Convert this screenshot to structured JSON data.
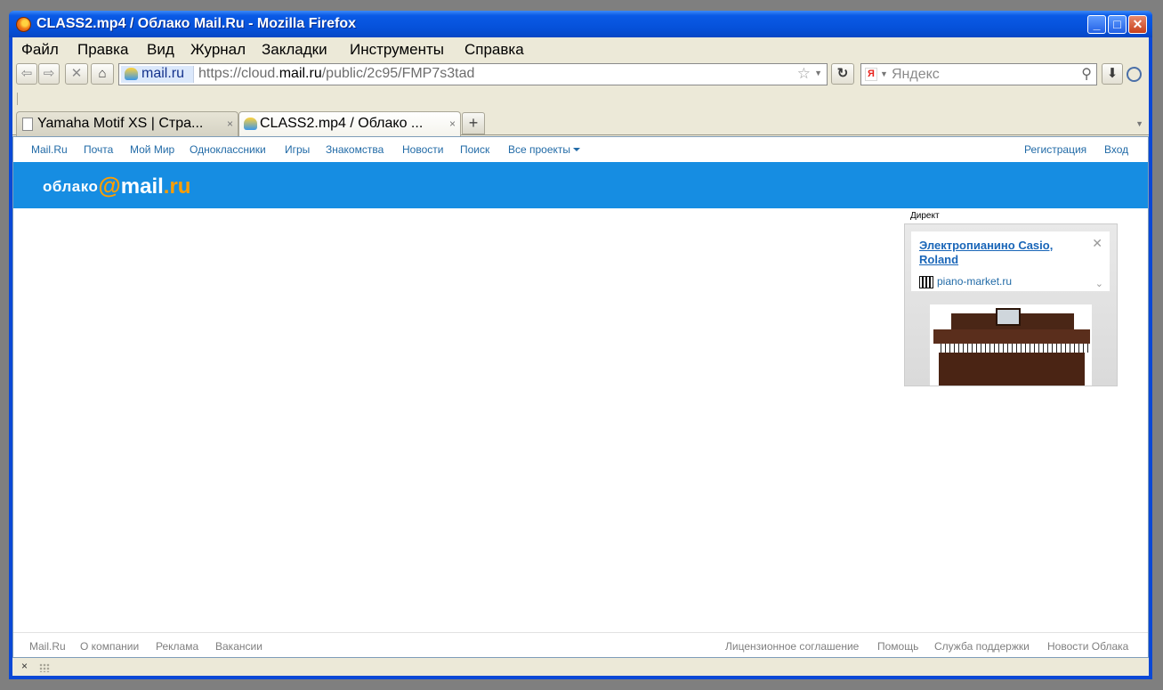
{
  "window": {
    "title": "CLASS2.mp4 / Облако Mail.Ru - Mozilla Firefox",
    "controls": {
      "minimize": "_",
      "maximize": "□",
      "close": "✕"
    }
  },
  "menubar": {
    "items": [
      {
        "label": "Файл"
      },
      {
        "label": "Правка"
      },
      {
        "label": "Вид"
      },
      {
        "label": "Журнал"
      },
      {
        "label": "Закладки"
      },
      {
        "label": "Инструменты"
      },
      {
        "label": "Справка"
      }
    ]
  },
  "navbar": {
    "back": "⇦",
    "forward": "⇨",
    "stop": "✕",
    "home": "⌂",
    "site_identity": "mail.ru",
    "url_prefix": "https://cloud.",
    "url_host": "mail.ru",
    "url_path": "/public/2c95/FMP7s3tad",
    "star": "☆",
    "url_dropdown": "▼",
    "reload": "↻",
    "search_engine_glyph": "Я",
    "search_dropdown": "▼",
    "search_placeholder": "Яндекс",
    "search_glyph": "⚲",
    "download": "⬇"
  },
  "tabs": [
    {
      "label": "Yamaha Motif XS | Стра...",
      "close": "×",
      "active": false
    },
    {
      "label": "CLASS2.mp4 / Облако ...",
      "close": "×",
      "active": true
    }
  ],
  "new_tab": "+",
  "tab_list": "▼",
  "portal_bar": {
    "left": [
      {
        "label": "Mail.Ru"
      },
      {
        "label": "Почта"
      },
      {
        "label": "Мой Мир"
      },
      {
        "label": "Одноклассники"
      },
      {
        "label": "Игры"
      },
      {
        "label": "Знакомства"
      },
      {
        "label": "Новости"
      },
      {
        "label": "Поиск"
      },
      {
        "label": "Все проекты"
      }
    ],
    "right": [
      {
        "label": "Регистрация"
      },
      {
        "label": "Вход"
      }
    ]
  },
  "logo": {
    "word": "облако",
    "at": "@",
    "mail": "mail",
    "ru": ".ru"
  },
  "ad": {
    "label": "Директ",
    "title": "Электропианино Casio, Roland",
    "domain": "piano-market.ru",
    "close": "✕",
    "expand": "⌄"
  },
  "footer": {
    "left": [
      {
        "label": "Mail.Ru"
      },
      {
        "label": "О компании"
      },
      {
        "label": "Реклама"
      },
      {
        "label": "Вакансии"
      }
    ],
    "right": [
      {
        "label": "Лицензионное соглашение"
      },
      {
        "label": "Помощь"
      },
      {
        "label": "Служба поддержки"
      },
      {
        "label": "Новости Облака"
      }
    ]
  },
  "statusbar": {
    "close": "×"
  },
  "colors": {
    "header_blue": "#168de2",
    "logo_orange": "#ff9e00",
    "link_blue": "#226ba7",
    "titlebar_blue": "#0550d8"
  }
}
